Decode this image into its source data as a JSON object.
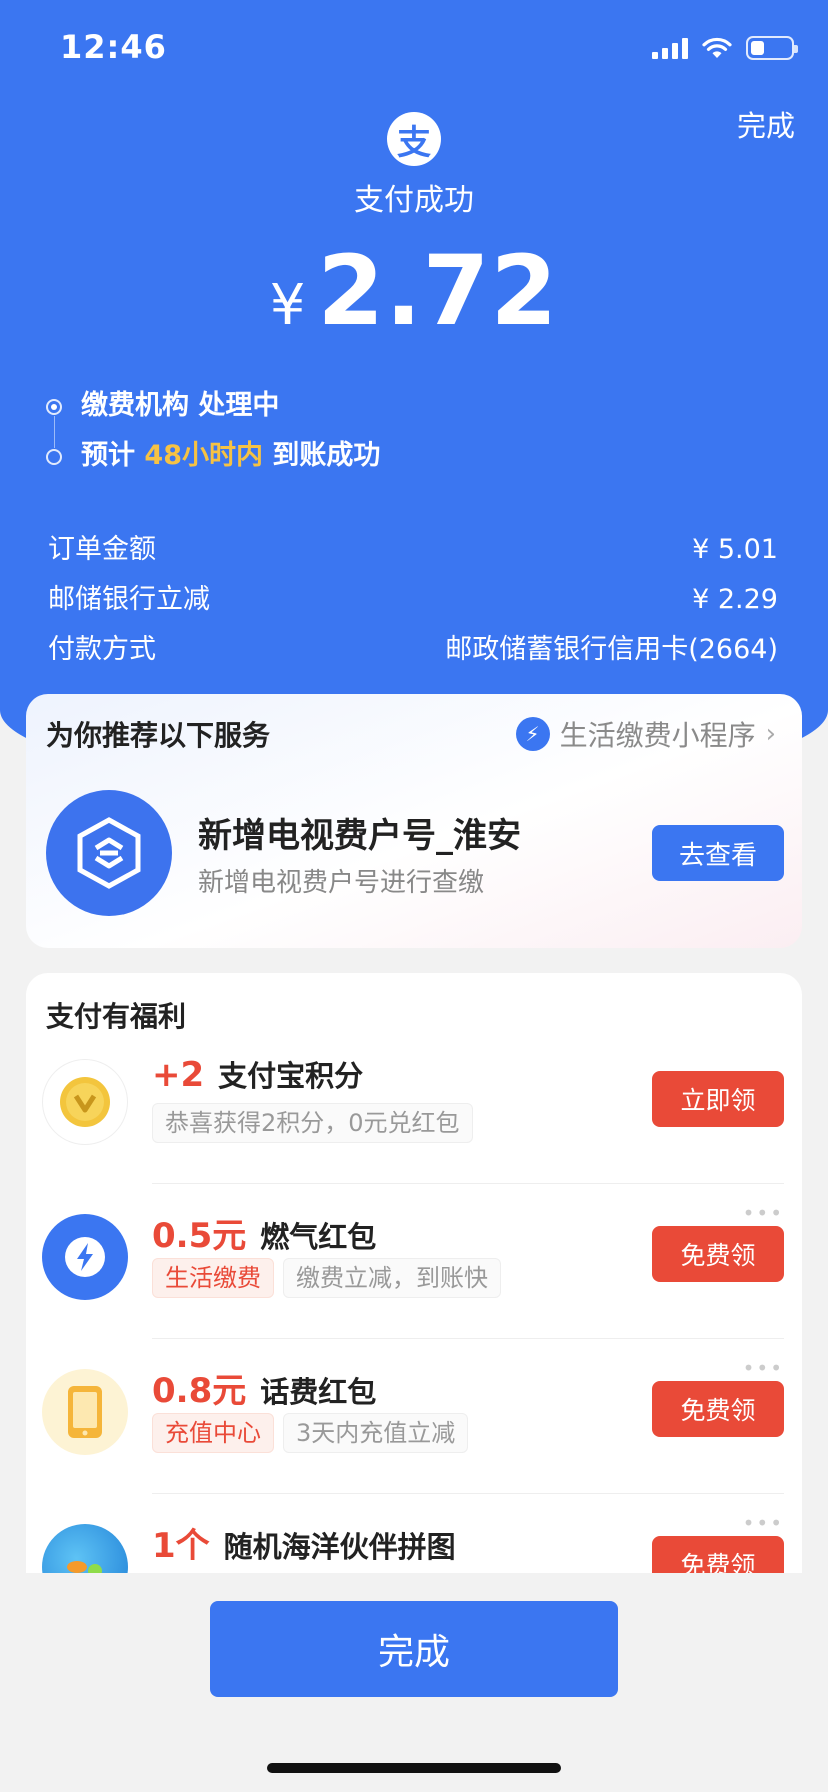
{
  "status_bar": {
    "time": "12:46",
    "icons": [
      "signal-icon",
      "wifi-icon",
      "battery-icon"
    ]
  },
  "header": {
    "done_label": "完成",
    "logo_char": "支",
    "status_title": "支付成功",
    "currency": "¥",
    "amount": "2.72"
  },
  "progress": {
    "step1": "缴费机构 处理中",
    "step2_prefix": "预计",
    "step2_highlight": "48小时内",
    "step2_suffix": "到账成功"
  },
  "details": [
    {
      "label": "订单金额",
      "value": "¥ 5.01"
    },
    {
      "label": "邮储银行立减",
      "value": "¥ 2.29"
    },
    {
      "label": "付款方式",
      "value": "邮政储蓄银行信用卡(2664)"
    }
  ],
  "recommend": {
    "title": "为你推荐以下服务",
    "mini_program": "生活缴费小程序",
    "service_name": "新增电视费户号_淮安",
    "service_desc": "新增电视费户号进行查缴",
    "button": "去查看"
  },
  "benefits": {
    "title": "支付有福利",
    "items": [
      {
        "amount": "+2",
        "name": "支付宝积分",
        "tags": [
          "恭喜获得2积分，0元兑红包"
        ],
        "button": "立即领"
      },
      {
        "amount": "0.5元",
        "name": "燃气红包",
        "tags": [
          "生活缴费",
          "缴费立减，到账快"
        ],
        "button": "免费领"
      },
      {
        "amount": "0.8元",
        "name": "话费红包",
        "tags": [
          "充值中心",
          "3天内充值立减"
        ],
        "button": "免费领"
      },
      {
        "amount": "1个",
        "name": "随机海洋伙伴拼图",
        "button": "免费领"
      }
    ]
  },
  "footer": {
    "done_button": "完成"
  },
  "colors": {
    "primary": "#3b76f1",
    "accent_red": "#e94a38",
    "highlight_yellow": "#f6c244"
  }
}
